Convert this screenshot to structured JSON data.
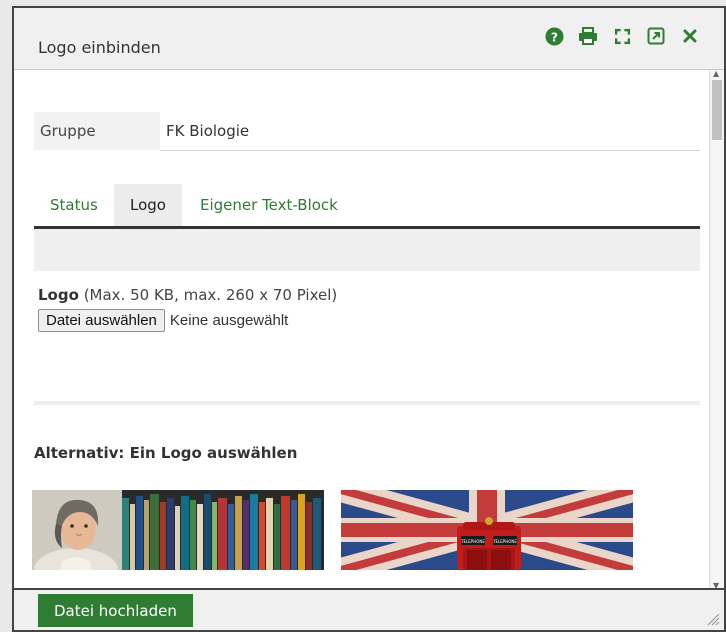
{
  "dialog": {
    "title": "Logo einbinden",
    "header_icons": [
      "help-icon",
      "print-icon",
      "fullscreen-icon",
      "open-external-icon",
      "close-icon"
    ]
  },
  "form": {
    "gruppe_label": "Gruppe",
    "gruppe_value": "FK Biologie"
  },
  "tabs": [
    {
      "label": "Status",
      "active": false
    },
    {
      "label": "Logo",
      "active": true
    },
    {
      "label": "Eigener Text-Block",
      "active": false
    }
  ],
  "logo": {
    "label": "Logo",
    "hint": "(Max. 50 KB, max. 260 x 70 Pixel)",
    "file_button": "Datei auswählen",
    "file_status": "Keine ausgewählt"
  },
  "alternative": {
    "title": "Alternativ: Ein Logo auswählen",
    "thumbnails": [
      {
        "name": "goethe-bookshelf-logo",
        "sign_text": []
      },
      {
        "name": "union-jack-phonebox-logo",
        "sign_text": [
          "TELEPHONE",
          "TELEPHONE"
        ]
      }
    ]
  },
  "footer": {
    "upload_label": "Datei hochladen"
  },
  "colors": {
    "accent": "#2e7d32",
    "header_bg": "#f0f0f0",
    "border": "#444444"
  }
}
